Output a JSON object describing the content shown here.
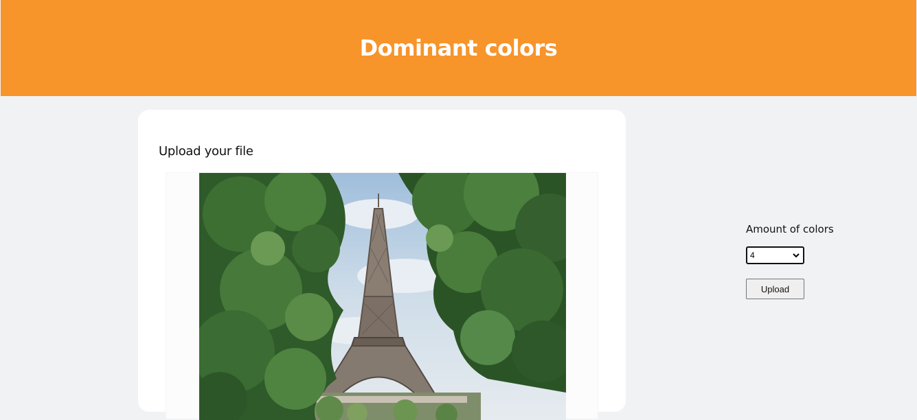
{
  "header": {
    "title": "Dominant colors"
  },
  "upload_card": {
    "title": "Upload your file",
    "image_subject": "eiffel-tower-photo"
  },
  "controls": {
    "amount_label": "Amount of colors",
    "amount_value": "4",
    "upload_label": "Upload"
  },
  "colors": {
    "header_bg": "#f7942a",
    "page_bg": "#f1f2f4",
    "card_bg": "#ffffff"
  }
}
